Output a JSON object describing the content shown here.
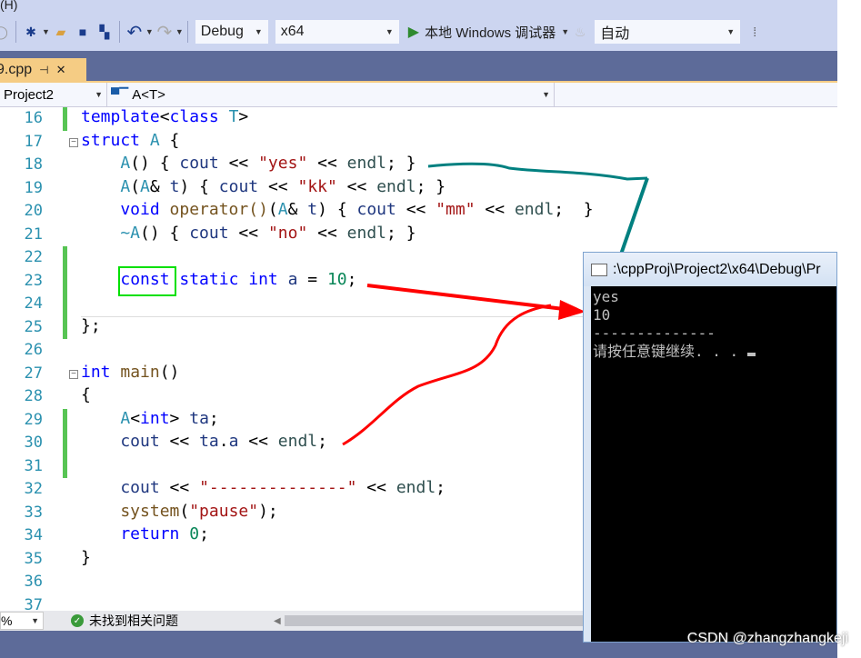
{
  "menu": {
    "help_fragment": "(H)"
  },
  "toolbar": {
    "config": "Debug",
    "platform": "x64",
    "run_label": "本地 Windows 调试器",
    "solution_config": "自动"
  },
  "tab": {
    "filename": "9.cpp",
    "pin": "⊣",
    "close": "✕"
  },
  "navbar": {
    "project": "Project2",
    "scope": "A<T>",
    "member": ""
  },
  "code": {
    "lines": [
      {
        "n": "16",
        "changed": true,
        "tokens": [
          [
            "template",
            "kw"
          ],
          [
            "<",
            "pl"
          ],
          [
            "class",
            "kw"
          ],
          [
            " T",
            "ty"
          ],
          [
            ">",
            "pl"
          ]
        ]
      },
      {
        "n": "17",
        "fold": true,
        "tokens": [
          [
            "struct",
            "kw"
          ],
          [
            " A ",
            "ty"
          ],
          [
            "{",
            "pl"
          ]
        ]
      },
      {
        "n": "18",
        "tokens": [
          [
            "    A",
            "ty"
          ],
          [
            "() { ",
            "pl"
          ],
          [
            "cout",
            "vr"
          ],
          [
            " << ",
            "pl"
          ],
          [
            "\"yes\"",
            "st"
          ],
          [
            " << ",
            "pl"
          ],
          [
            "endl",
            "en"
          ],
          [
            "; }",
            "pl"
          ]
        ]
      },
      {
        "n": "19",
        "tokens": [
          [
            "    A",
            "ty"
          ],
          [
            "(",
            "pl"
          ],
          [
            "A",
            "ty"
          ],
          [
            "& ",
            "pl"
          ],
          [
            "t",
            "vr"
          ],
          [
            ") { ",
            "pl"
          ],
          [
            "cout",
            "vr"
          ],
          [
            " << ",
            "pl"
          ],
          [
            "\"kk\"",
            "st"
          ],
          [
            " << ",
            "pl"
          ],
          [
            "endl",
            "en"
          ],
          [
            "; }",
            "pl"
          ]
        ]
      },
      {
        "n": "20",
        "tokens": [
          [
            "    void",
            "kw"
          ],
          [
            " operator()",
            "fn"
          ],
          [
            "(",
            "pl"
          ],
          [
            "A",
            "ty"
          ],
          [
            "& ",
            "pl"
          ],
          [
            "t",
            "vr"
          ],
          [
            ") { ",
            "pl"
          ],
          [
            "cout",
            "vr"
          ],
          [
            " << ",
            "pl"
          ],
          [
            "\"mm\"",
            "st"
          ],
          [
            " << ",
            "pl"
          ],
          [
            "endl",
            "en"
          ],
          [
            ";  }",
            "pl"
          ]
        ]
      },
      {
        "n": "21",
        "tokens": [
          [
            "    ~A",
            "ty"
          ],
          [
            "() { ",
            "pl"
          ],
          [
            "cout",
            "vr"
          ],
          [
            " << ",
            "pl"
          ],
          [
            "\"no\"",
            "st"
          ],
          [
            " << ",
            "pl"
          ],
          [
            "endl",
            "en"
          ],
          [
            "; }",
            "pl"
          ]
        ]
      },
      {
        "n": "22",
        "changed": true,
        "tokens": []
      },
      {
        "n": "23",
        "changed": true,
        "tokens": [
          [
            "    ",
            "pl"
          ],
          [
            "const",
            "kw"
          ],
          [
            " static int",
            "kw"
          ],
          [
            " a",
            "vr"
          ],
          [
            " = ",
            "pl"
          ],
          [
            "10",
            "nm"
          ],
          [
            ";",
            "pl"
          ]
        ]
      },
      {
        "n": "24",
        "changed": true,
        "tokens": []
      },
      {
        "n": "25",
        "changed": true,
        "tokens": [
          [
            "};",
            "pl"
          ]
        ]
      },
      {
        "n": "26",
        "tokens": []
      },
      {
        "n": "27",
        "fold": true,
        "tokens": [
          [
            "int",
            "kw"
          ],
          [
            " main",
            "fn"
          ],
          [
            "()",
            "pl"
          ]
        ]
      },
      {
        "n": "28",
        "tokens": [
          [
            "{",
            "pl"
          ]
        ]
      },
      {
        "n": "29",
        "changed": true,
        "tokens": [
          [
            "    A",
            "ty"
          ],
          [
            "<",
            "pl"
          ],
          [
            "int",
            "kw"
          ],
          [
            "> ",
            "pl"
          ],
          [
            "ta",
            "vr"
          ],
          [
            ";",
            "pl"
          ]
        ]
      },
      {
        "n": "30",
        "changed": true,
        "tokens": [
          [
            "    cout",
            "vr"
          ],
          [
            " << ",
            "pl"
          ],
          [
            "ta",
            "vr"
          ],
          [
            ".",
            "pl"
          ],
          [
            "a",
            "vr"
          ],
          [
            " << ",
            "pl"
          ],
          [
            "endl",
            "en"
          ],
          [
            ";",
            "pl"
          ]
        ]
      },
      {
        "n": "31",
        "changed": true,
        "tokens": []
      },
      {
        "n": "32",
        "tokens": [
          [
            "    cout",
            "vr"
          ],
          [
            " << ",
            "pl"
          ],
          [
            "\"--------------\"",
            "st"
          ],
          [
            " << ",
            "pl"
          ],
          [
            "endl",
            "en"
          ],
          [
            ";",
            "pl"
          ]
        ]
      },
      {
        "n": "33",
        "tokens": [
          [
            "    system",
            "fn"
          ],
          [
            "(",
            "pl"
          ],
          [
            "\"pause\"",
            "st"
          ],
          [
            ");",
            "pl"
          ]
        ]
      },
      {
        "n": "34",
        "tokens": [
          [
            "    return",
            "kw"
          ],
          [
            " ",
            "pl"
          ],
          [
            "0",
            "nm"
          ],
          [
            ";",
            "pl"
          ]
        ]
      },
      {
        "n": "35",
        "tokens": [
          [
            "}",
            "pl"
          ]
        ]
      },
      {
        "n": "36",
        "tokens": []
      },
      {
        "n": "37",
        "tokens": []
      }
    ]
  },
  "status": {
    "zoom": "%",
    "issues": "未找到相关问题"
  },
  "console": {
    "title": ":\\cppProj\\Project2\\x64\\Debug\\Pr",
    "output": [
      "yes",
      "10",
      "--------------",
      "请按任意键继续. . . "
    ]
  },
  "watermark": "CSDN @zhangzhangkeji",
  "colors": {
    "toolbar": "#ccd5f0",
    "tab_active": "#f5cc84",
    "annotation_teal": "#008080",
    "annotation_red": "#ff0000",
    "highlight_green": "#00e000"
  }
}
